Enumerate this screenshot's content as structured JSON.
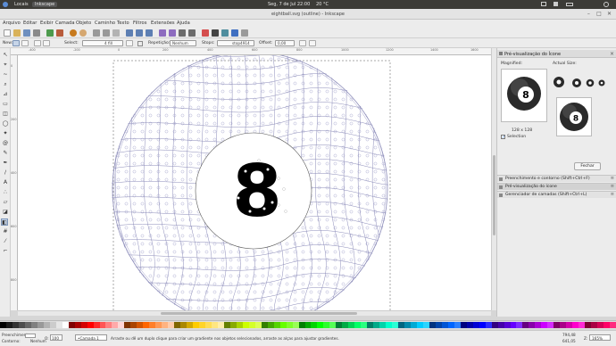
{
  "system_bar": {
    "places": "Locais",
    "app": "Inkscape",
    "clock": "Seg, 7 de Jul 22:00",
    "weather": "20 °C"
  },
  "window": {
    "title": "eightball.svg (outline) - Inkscape",
    "minimize": "–",
    "maximize": "□",
    "close": "✕"
  },
  "menu": [
    "Arquivo",
    "Editar",
    "Exibir",
    "Camada",
    "Objeto",
    "Caminho",
    "Texto",
    "Filtros",
    "Extensões",
    "Ajuda"
  ],
  "controls": {
    "new_label": "New:",
    "select_label": "Select:",
    "select_value": "4 fill",
    "repeat_label": "Repetição:",
    "repeat_value": "Nenhum",
    "stops_label": "Stops:",
    "stop_value": "stop4914",
    "offset_label": "Offset:",
    "offset_value": "0,00"
  },
  "ruler": {
    "h_ticks": [
      "-400",
      "-200",
      "0",
      "200",
      "400",
      "600",
      "800",
      "1000",
      "1200",
      "1400",
      "1600"
    ],
    "v_ticks": [
      "0",
      "200",
      "400",
      "600",
      "800"
    ]
  },
  "drawing": {
    "label": "8",
    "colors": {
      "outline": "#8a8ab8",
      "glyph": "#000000",
      "page_border": "#555555"
    }
  },
  "panel": {
    "title": "Pré-visualização do Ícone",
    "magnified": "Magnified:",
    "actual_size": "Actual Size:",
    "size_caption": "128 x 128",
    "selection": "Selection",
    "close_button": "Fechar",
    "docked": [
      {
        "label": "Preenchimento e contorno (Shift+Ctrl+F)"
      },
      {
        "label": "Pré-visualização do ícone"
      },
      {
        "label": "Gerenciador de camadas (Shift+Ctrl+L)"
      }
    ]
  },
  "palette": {
    "colors": [
      "#000000",
      "#1a1a1a",
      "#333333",
      "#4d4d4d",
      "#666666",
      "#808080",
      "#999999",
      "#b3b3b3",
      "#cccccc",
      "#e6e6e6",
      "#ffffff",
      "#800000",
      "#aa0000",
      "#d40000",
      "#ff0000",
      "#ff2a2a",
      "#ff5555",
      "#ff8080",
      "#ffaaaa",
      "#ffd5d5",
      "#803300",
      "#aa4400",
      "#d45500",
      "#ff6600",
      "#ff7f2a",
      "#ff9955",
      "#ffb380",
      "#ffccaa",
      "#806600",
      "#aa8800",
      "#d4aa00",
      "#ffcc00",
      "#ffd42a",
      "#ffdd55",
      "#ffe680",
      "#ffeeaa",
      "#668000",
      "#88aa00",
      "#aad400",
      "#ccff00",
      "#d4ff2a",
      "#ddff55",
      "#338000",
      "#44aa00",
      "#55d400",
      "#66ff00",
      "#7fff2a",
      "#99ff55",
      "#008000",
      "#00aa00",
      "#00d400",
      "#00ff00",
      "#2aff2a",
      "#55ff55",
      "#008033",
      "#00aa44",
      "#00d455",
      "#00ff66",
      "#2aff80",
      "#008066",
      "#00aa88",
      "#00d4aa",
      "#00ffcc",
      "#2affd5",
      "#006680",
      "#0088aa",
      "#00aad4",
      "#00ccff",
      "#2ad4ff",
      "#003380",
      "#0044aa",
      "#0055d4",
      "#0066ff",
      "#2a7fff",
      "#000080",
      "#0000aa",
      "#0000d4",
      "#0000ff",
      "#2a2aff",
      "#330080",
      "#4400aa",
      "#5500d4",
      "#6600ff",
      "#7f2aff",
      "#660080",
      "#8800aa",
      "#aa00d4",
      "#cc00ff",
      "#d42aff",
      "#800066",
      "#aa0088",
      "#d400aa",
      "#ff00cc",
      "#ff2ad4",
      "#800033",
      "#aa0044",
      "#d40055",
      "#ff0066",
      "#ff2a7f"
    ]
  },
  "status": {
    "fill_label": "Preenchimento:",
    "stroke_label": "Contorno:",
    "none_label": "Nenhum",
    "opacity_label": "O:",
    "opacity_value": "100",
    "layer": "•Camada 1",
    "message": "Arraste ou dê um duplo clique para criar um gradiente nos objetos selecionados, arraste as alças para ajustar gradientes.",
    "coord_x": "794,48",
    "coord_y": "641,05",
    "zoom_label": "Z:",
    "zoom_value": "165%"
  }
}
